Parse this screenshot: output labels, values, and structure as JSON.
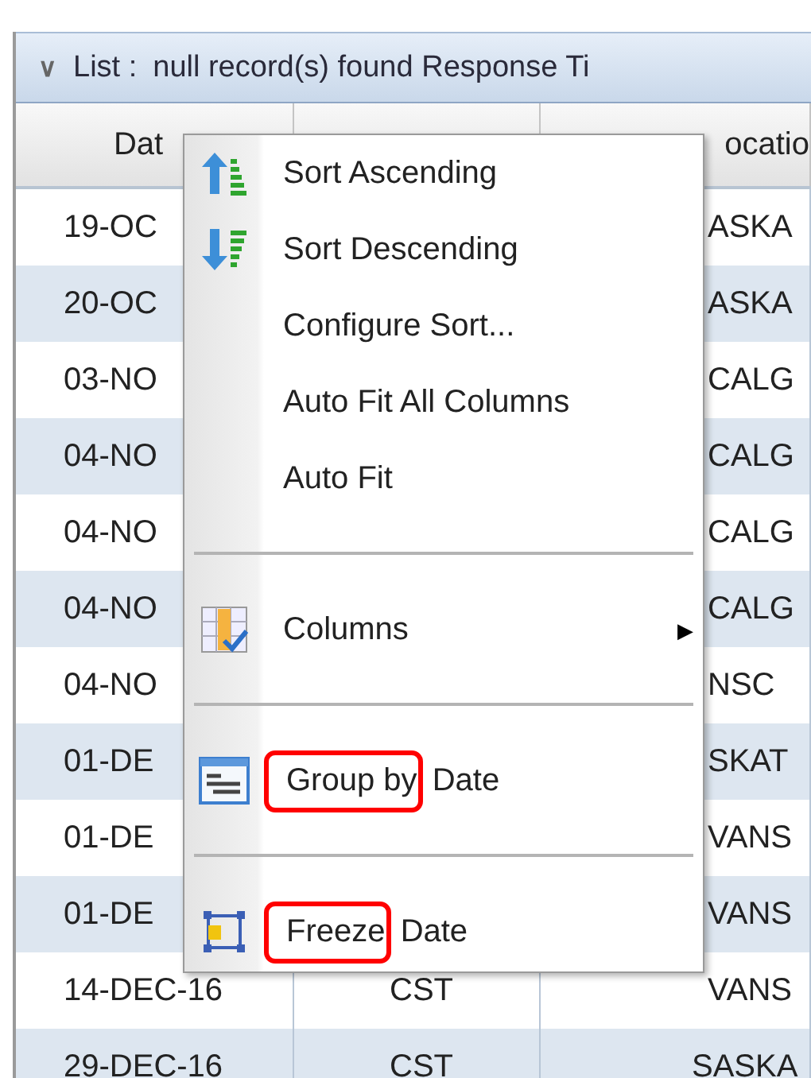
{
  "panel": {
    "caret": "∨",
    "title": "List :",
    "status": "null  record(s) found Response Ti"
  },
  "table": {
    "columns": [
      "Dat",
      "",
      "ocatio"
    ],
    "rows": [
      {
        "cells": [
          "19-OC",
          "",
          "ASKA"
        ]
      },
      {
        "cells": [
          "20-OC",
          "",
          "ASKA"
        ]
      },
      {
        "cells": [
          "03-NO",
          "",
          "CALG"
        ]
      },
      {
        "cells": [
          "04-NO",
          "",
          "CALG"
        ]
      },
      {
        "cells": [
          "04-NO",
          "",
          "CALG"
        ]
      },
      {
        "cells": [
          "04-NO",
          "",
          "CALG"
        ]
      },
      {
        "cells": [
          "04-NO",
          "",
          "NSC"
        ]
      },
      {
        "cells": [
          "01-DE",
          "",
          "SKAT"
        ]
      },
      {
        "cells": [
          "01-DE",
          "",
          "VANS"
        ]
      },
      {
        "cells": [
          "01-DE",
          "",
          "VANS"
        ]
      },
      {
        "cells": [
          "14-DEC-16",
          "CST",
          "VANS"
        ]
      },
      {
        "cells": [
          "29-DEC-16",
          "CST",
          "SASKA"
        ]
      }
    ]
  },
  "context_menu": {
    "groups": [
      {
        "items": [
          {
            "kind": "sort-ascending",
            "label_parts": [
              "Sort Ascending"
            ]
          },
          {
            "kind": "sort-descending",
            "label_parts": [
              "Sort Descending"
            ]
          },
          {
            "kind": "plain",
            "label_parts": [
              "Configure Sort..."
            ]
          },
          {
            "kind": "plain",
            "label_parts": [
              "Auto Fit All Columns"
            ]
          },
          {
            "kind": "plain",
            "label_parts": [
              "Auto Fit"
            ]
          }
        ]
      },
      {
        "items": [
          {
            "kind": "columns",
            "label_parts": [
              "Columns"
            ],
            "submenu": "▶"
          }
        ]
      },
      {
        "items": [
          {
            "kind": "group",
            "label_parts": [
              "Group by",
              "Date"
            ],
            "annotated": true
          }
        ]
      },
      {
        "items": [
          {
            "kind": "freeze",
            "label_parts": [
              "Freeze",
              "Date"
            ],
            "annotated": true
          }
        ]
      }
    ]
  }
}
